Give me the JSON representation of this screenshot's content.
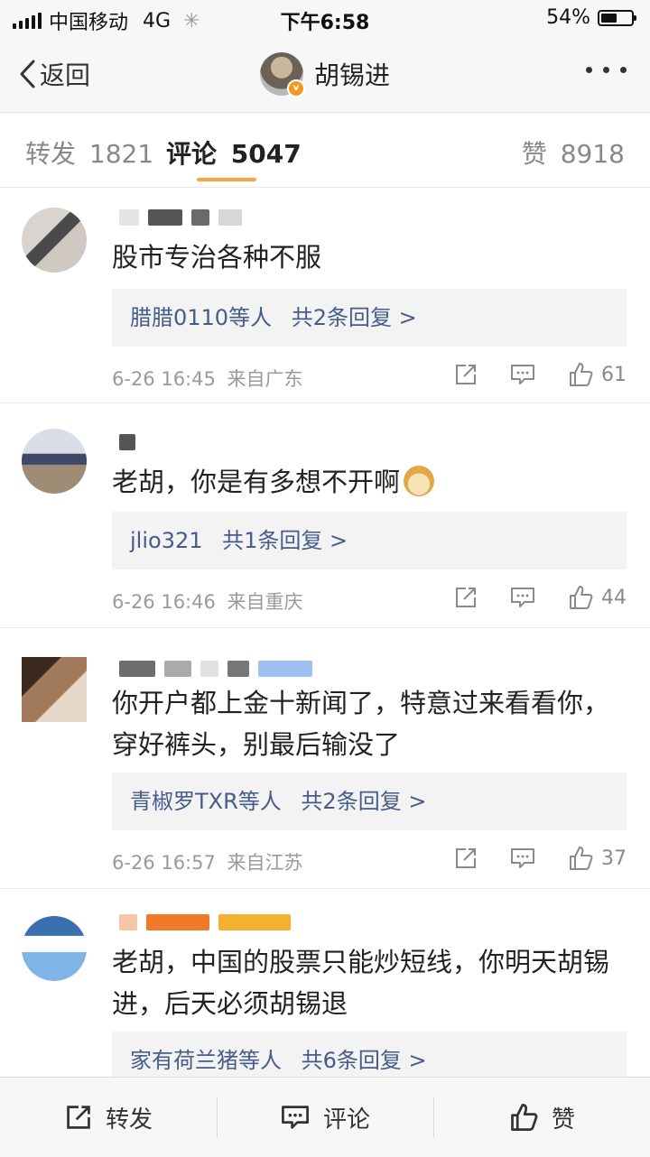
{
  "status_bar": {
    "carrier": "中国移动",
    "network": "4G",
    "time": "下午6:58",
    "battery": "54%",
    "battery_level": 0.54
  },
  "nav": {
    "back_label": "返回",
    "title": "胡锡进"
  },
  "tabs": {
    "repost": {
      "label": "转发",
      "count": "1821"
    },
    "comment": {
      "label": "评论",
      "count": "5047"
    },
    "like": {
      "label": "赞",
      "count": "8918"
    }
  },
  "comments": [
    {
      "text": "股市专治各种不服",
      "reply_names": "腊腊0110等人",
      "reply_count": "共2条回复 >",
      "time": "6-26 16:45",
      "source": "来自广东",
      "likes": "61"
    },
    {
      "text": "老胡，你是有多想不开啊",
      "reply_names": "jlio321",
      "reply_count": "共1条回复 >",
      "time": "6-26 16:46",
      "source": "来自重庆",
      "likes": "44"
    },
    {
      "text": "你开户都上金十新闻了，特意过来看看你，穿好裤头，别最后输没了",
      "reply_names": "青椒罗TXR等人",
      "reply_count": "共2条回复 >",
      "time": "6-26 16:57",
      "source": "来自江苏",
      "likes": "37"
    },
    {
      "text": "老胡，中国的股票只能炒短线，你明天胡锡进，后天必须胡锡退",
      "reply_names": "家有荷兰猪等人",
      "reply_count": "共6条回复 >",
      "time": "",
      "source": "",
      "likes": ""
    }
  ],
  "bottom_bar": {
    "repost_label": "转发",
    "comment_label": "评论",
    "like_label": "赞"
  }
}
